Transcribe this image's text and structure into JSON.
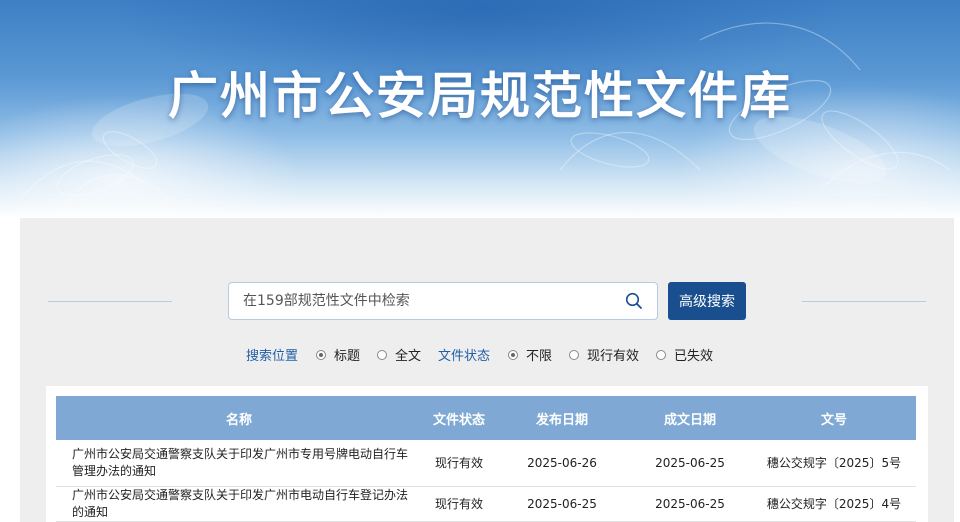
{
  "banner": {
    "title": "广州市公安局规范性文件库"
  },
  "search": {
    "placeholder": "在159部规范性文件中检索",
    "value": "",
    "icon": "search-icon",
    "advanced_label": "高级搜索"
  },
  "filters": {
    "position_label": "搜索位置",
    "position_options": [
      {
        "label": "标题",
        "checked": true
      },
      {
        "label": "全文",
        "checked": false
      }
    ],
    "status_label": "文件状态",
    "status_options": [
      {
        "label": "不限",
        "checked": true
      },
      {
        "label": "现行有效",
        "checked": false
      },
      {
        "label": "已失效",
        "checked": false
      }
    ]
  },
  "table": {
    "columns": [
      "名称",
      "文件状态",
      "发布日期",
      "成文日期",
      "文号"
    ],
    "rows": [
      {
        "name": "广州市公安局交通警察支队关于印发广州市专用号牌电动自行车管理办法的通知",
        "status": "现行有效",
        "publish_date": "2025-06-26",
        "written_date": "2025-06-25",
        "doc_no": "穗公交规字〔2025〕5号"
      },
      {
        "name": "广州市公安局交通警察支队关于印发广州市电动自行车登记办法的通知",
        "status": "现行有效",
        "publish_date": "2025-06-25",
        "written_date": "2025-06-25",
        "doc_no": "穗公交规字〔2025〕4号"
      }
    ]
  },
  "colors": {
    "accent": "#1a4f8f",
    "header_bg": "#7fa9d4",
    "label_blue": "#1f5fa6"
  }
}
